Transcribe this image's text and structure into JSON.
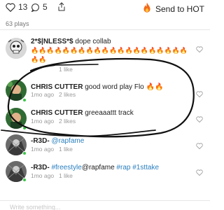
{
  "stats": {
    "likes": "13",
    "comments": "5"
  },
  "send_to_hot_label": "Send to HOT",
  "plays_label": "63 plays",
  "comments": [
    {
      "author": "2*$|NLESS*$",
      "text": " dope collab ",
      "time": "",
      "likes": "1 like",
      "emoji": "🔥🔥🔥🔥🔥🔥🔥🔥🔥🔥🔥🔥🔥🔥🔥🔥🔥🔥🔥🔥🔥🔥"
    },
    {
      "author": "CHRIS CUTTER",
      "text": " good word play Flo ",
      "time": "1mo ago",
      "likes": "2 likes",
      "emoji": "🔥🔥"
    },
    {
      "author": "CHRIS CUTTER",
      "text": " greeaaattt track",
      "time": "1mo ago",
      "likes": "2 likes",
      "emoji": ""
    },
    {
      "author": "-R3D-",
      "text": " ",
      "mention": "@rapfame",
      "time": "1mo ago",
      "likes": "1 like"
    },
    {
      "author": "-R3D-",
      "hashtag": "#freestyle",
      "mention": "@rapfame",
      "hashtag2": " #rap #1sttake",
      "time": "1mo ago",
      "likes": "1 like"
    }
  ],
  "input": {
    "placeholder": "Write something..."
  },
  "colors": {
    "accent_fire": "#f26a1b",
    "mention_blue": "#2a7fbf",
    "online_green": "#3cc447"
  }
}
